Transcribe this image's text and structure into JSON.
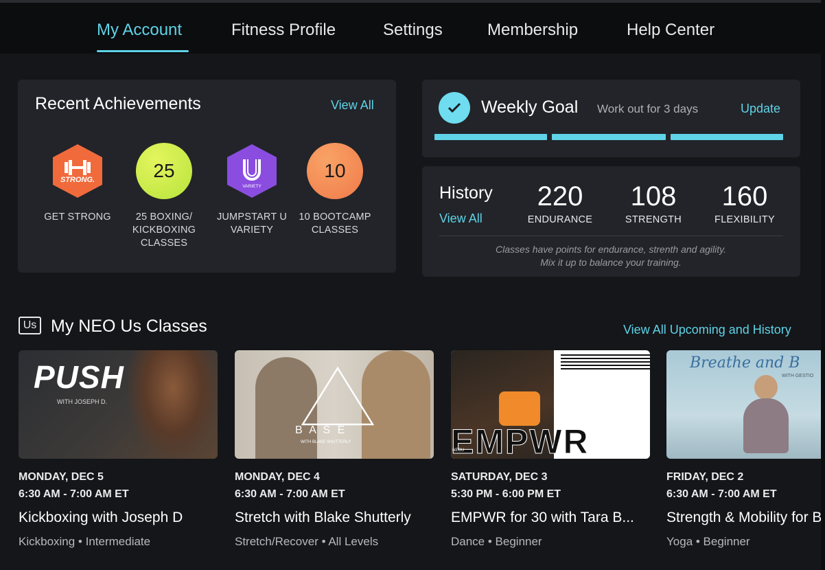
{
  "nav": {
    "tabs": [
      {
        "label": "My Account",
        "active": true
      },
      {
        "label": "Fitness Profile",
        "active": false
      },
      {
        "label": "Settings",
        "active": false
      },
      {
        "label": "Membership",
        "active": false
      },
      {
        "label": "Help Center",
        "active": false
      }
    ]
  },
  "achievements": {
    "title": "Recent Achievements",
    "view_all": "View All",
    "badges": [
      {
        "icon": "dumbbell-icon",
        "text": "STRONG.",
        "label": "GET STRONG",
        "color": "#f06a3c"
      },
      {
        "icon": "number-badge",
        "text": "25",
        "label": "25 BOXING/ KICKBOXING CLASSES",
        "color": "#c8ec4a"
      },
      {
        "icon": "u-logo-icon",
        "text": "VARIETY",
        "label": "JUMPSTART U VARIETY",
        "color": "#8b4de0"
      },
      {
        "icon": "number-badge",
        "text": "10",
        "label": "10 BOOTCAMP CLASSES",
        "color": "#f48a54"
      }
    ]
  },
  "weekly_goal": {
    "title": "Weekly Goal",
    "subtitle": "Work out for 3 days",
    "update": "Update",
    "progress_segments": 3,
    "completed_segments": 3,
    "accent": "#5fd3e8"
  },
  "history": {
    "title": "History",
    "view_all": "View All",
    "stats": [
      {
        "value": "220",
        "label": "ENDURANCE"
      },
      {
        "value": "108",
        "label": "STRENGTH"
      },
      {
        "value": "160",
        "label": "FLEXIBILITY"
      }
    ],
    "note_line1": "Classes have points for endurance, strenth and agility.",
    "note_line2": "Mix it up to balance your training."
  },
  "classes": {
    "icon_text": "Us",
    "title": "My NEO Us Classes",
    "view_all": "View All Upcoming and History",
    "items": [
      {
        "thumb_text": "PUSH",
        "thumb_sub": "WITH JOSEPH D.",
        "date": "MONDAY, DEC 5",
        "time": "6:30 AM - 7:00 AM ET",
        "title": "Kickboxing with Joseph D",
        "meta": "Kickboxing • Intermediate"
      },
      {
        "thumb_text": "B A S E",
        "thumb_sub": "WITH BLAKE SHUTTERLY",
        "date": "MONDAY, DEC 4",
        "time": "6:30 AM - 7:00 AM ET",
        "title": "Stretch with Blake Shutterly",
        "meta": "Stretch/Recover • All Levels"
      },
      {
        "thumb_text": "EMPWR",
        "thumb_sub": "NEOU",
        "date": "SATURDAY, DEC 3",
        "time": "5:30 PM - 6:00 PM ET",
        "title": "EMPWR for 30 with Tara B...",
        "meta": "Dance • Beginner"
      },
      {
        "thumb_text": "Breathe and B",
        "thumb_sub": "WITH GESTIO",
        "date": "FRIDAY, DEC 2",
        "time": "6:30 AM - 7:00 AM ET",
        "title": "Strength & Mobility for B",
        "meta": "Yoga • Beginner"
      }
    ]
  }
}
